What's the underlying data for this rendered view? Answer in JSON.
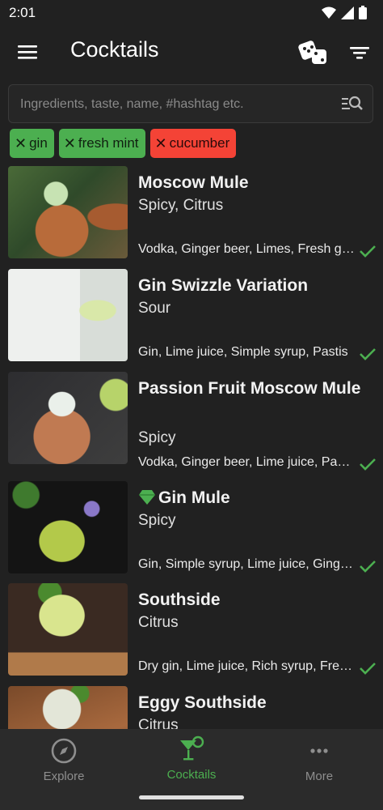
{
  "status": {
    "time": "2:01"
  },
  "appbar": {
    "title": "Cocktails"
  },
  "search": {
    "placeholder": "Ingredients, taste, name, #hashtag etc."
  },
  "chips": [
    {
      "label": "gin",
      "state": "include",
      "color": "#4caf50"
    },
    {
      "label": "fresh mint",
      "state": "include",
      "color": "#4caf50"
    },
    {
      "label": "cucumber",
      "state": "exclude",
      "color": "#f44336"
    }
  ],
  "items": [
    {
      "name": "Moscow Mule",
      "taste": "Spicy, Citrus",
      "ingredients": "Vodka, Ginger beer, Limes, Fresh ginger",
      "checked": true
    },
    {
      "name": "Gin Swizzle Variation",
      "taste": "Sour",
      "ingredients": "Gin, Lime juice, Simple syrup, Pastis",
      "checked": true
    },
    {
      "name": "Passion Fruit Moscow Mule",
      "taste": "Spicy",
      "ingredients": "Vodka, Ginger beer, Lime juice, Passion fruit",
      "checked": true
    },
    {
      "name": "Gin Mule",
      "taste": "Spicy",
      "ingredients": "Gin, Simple syrup, Lime juice, Ginger beer",
      "checked": true,
      "premium": true
    },
    {
      "name": "Southside",
      "taste": "Citrus",
      "ingredients": "Dry gin, Lime juice, Rich syrup, Fresh mint",
      "checked": true
    },
    {
      "name": "Eggy Southside",
      "taste": "Citrus",
      "ingredients": "",
      "checked": false
    }
  ],
  "nav": [
    {
      "label": "Explore",
      "icon": "compass-icon",
      "active": false
    },
    {
      "label": "Cocktails",
      "icon": "cocktail-glass-icon",
      "active": true
    },
    {
      "label": "More",
      "icon": "more-dots-icon",
      "active": false
    }
  ],
  "colors": {
    "accent": "#4caf50",
    "exclude": "#f44336",
    "background": "#212121"
  }
}
